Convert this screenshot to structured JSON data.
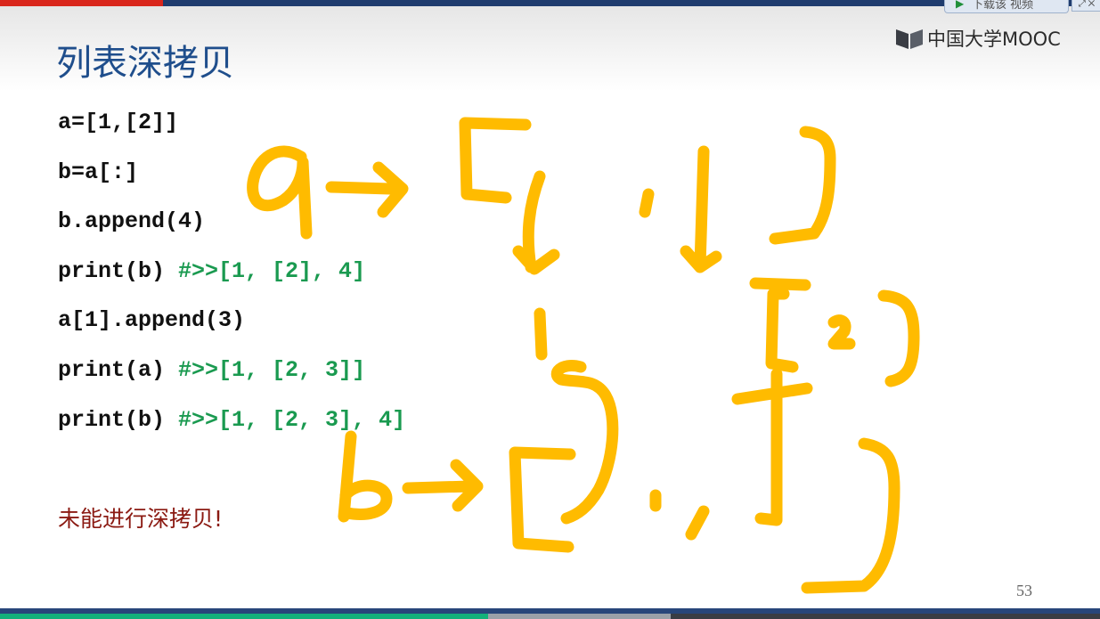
{
  "header": {
    "title": "列表深拷贝",
    "logo_text": "中国大学MOOC",
    "download_label": "下载该 视频",
    "window_controls": "⤢ ✕"
  },
  "code_lines": [
    {
      "code": "a=[1,[2]]",
      "comment": ""
    },
    {
      "code": "b=a[:]",
      "comment": ""
    },
    {
      "code": "b.append(4)",
      "comment": ""
    },
    {
      "code": "print(b) ",
      "comment": "#>>[1, [2], 4]"
    },
    {
      "code": "a[1].append(3)",
      "comment": ""
    },
    {
      "code": "print(a) ",
      "comment": "#>>[1, [2, 3]]"
    },
    {
      "code": "print(b) ",
      "comment": "#>>[1, [2, 3], 4]"
    }
  ],
  "note": "未能进行深拷贝!",
  "page_number": "53",
  "colors": {
    "title": "#1f4e8c",
    "comment": "#1a9a50",
    "note": "#8b1a12",
    "annotation_ink": "#ffbb00",
    "top_bar": "#1f3c6e",
    "top_bar_accent": "#d9261c"
  },
  "icons": [
    "mooc-book-logo-icon",
    "play-icon"
  ]
}
